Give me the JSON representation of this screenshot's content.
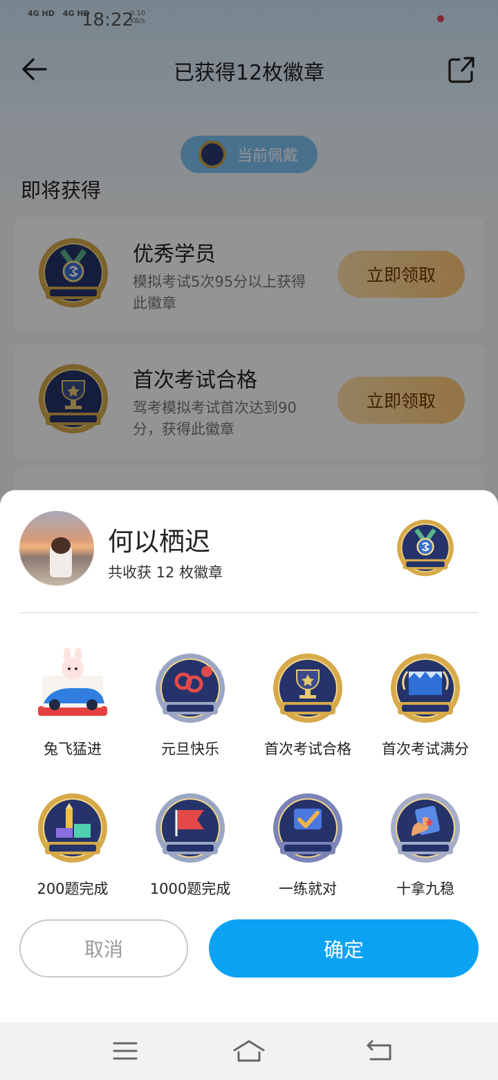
{
  "status_bar": {
    "signal_1": "4G HD",
    "signal_2": "4G HD",
    "time": "18:22",
    "speed_value": "0.10",
    "speed_unit": "KB/s"
  },
  "header": {
    "title": "已获得12枚徽章",
    "back_icon": "arrow-left-icon",
    "share_icon": "share-external-icon"
  },
  "wearing": {
    "label": "当前佩戴"
  },
  "section": {
    "title": "即将获得"
  },
  "upcoming": [
    {
      "name": "优秀学员",
      "desc": "模拟考试5次95分以上获得此徽章",
      "button": "立即领取",
      "icon": "excellent-student-badge"
    },
    {
      "name": "首次考试合格",
      "desc": "驾考模拟考试首次达到90分，获得此徽章",
      "button": "立即领取",
      "icon": "first-pass-badge"
    }
  ],
  "sheet": {
    "user_name": "何以栖迟",
    "collected": "共收获 12 枚徽章",
    "worn_badge_icon": "excellent-student-badge",
    "badges": [
      {
        "label": "兔飞猛进",
        "icon": "rabbit-car-badge"
      },
      {
        "label": "元旦快乐",
        "icon": "new-year-badge"
      },
      {
        "label": "首次考试合格",
        "icon": "first-pass-badge"
      },
      {
        "label": "首次考试满分",
        "icon": "full-score-100-badge"
      },
      {
        "label": "200题完成",
        "icon": "200-questions-badge"
      },
      {
        "label": "1000题完成",
        "icon": "1000-questions-badge"
      },
      {
        "label": "一练就对",
        "icon": "practice-correct-badge"
      },
      {
        "label": "十拿九稳",
        "icon": "sure-thing-badge"
      }
    ],
    "cancel": "取消",
    "confirm": "确定"
  },
  "colors": {
    "primary": "#0ba2f4",
    "claim_button": "#ffc878",
    "badge_navy": "#25336a",
    "badge_gold": "#d6a94a"
  }
}
